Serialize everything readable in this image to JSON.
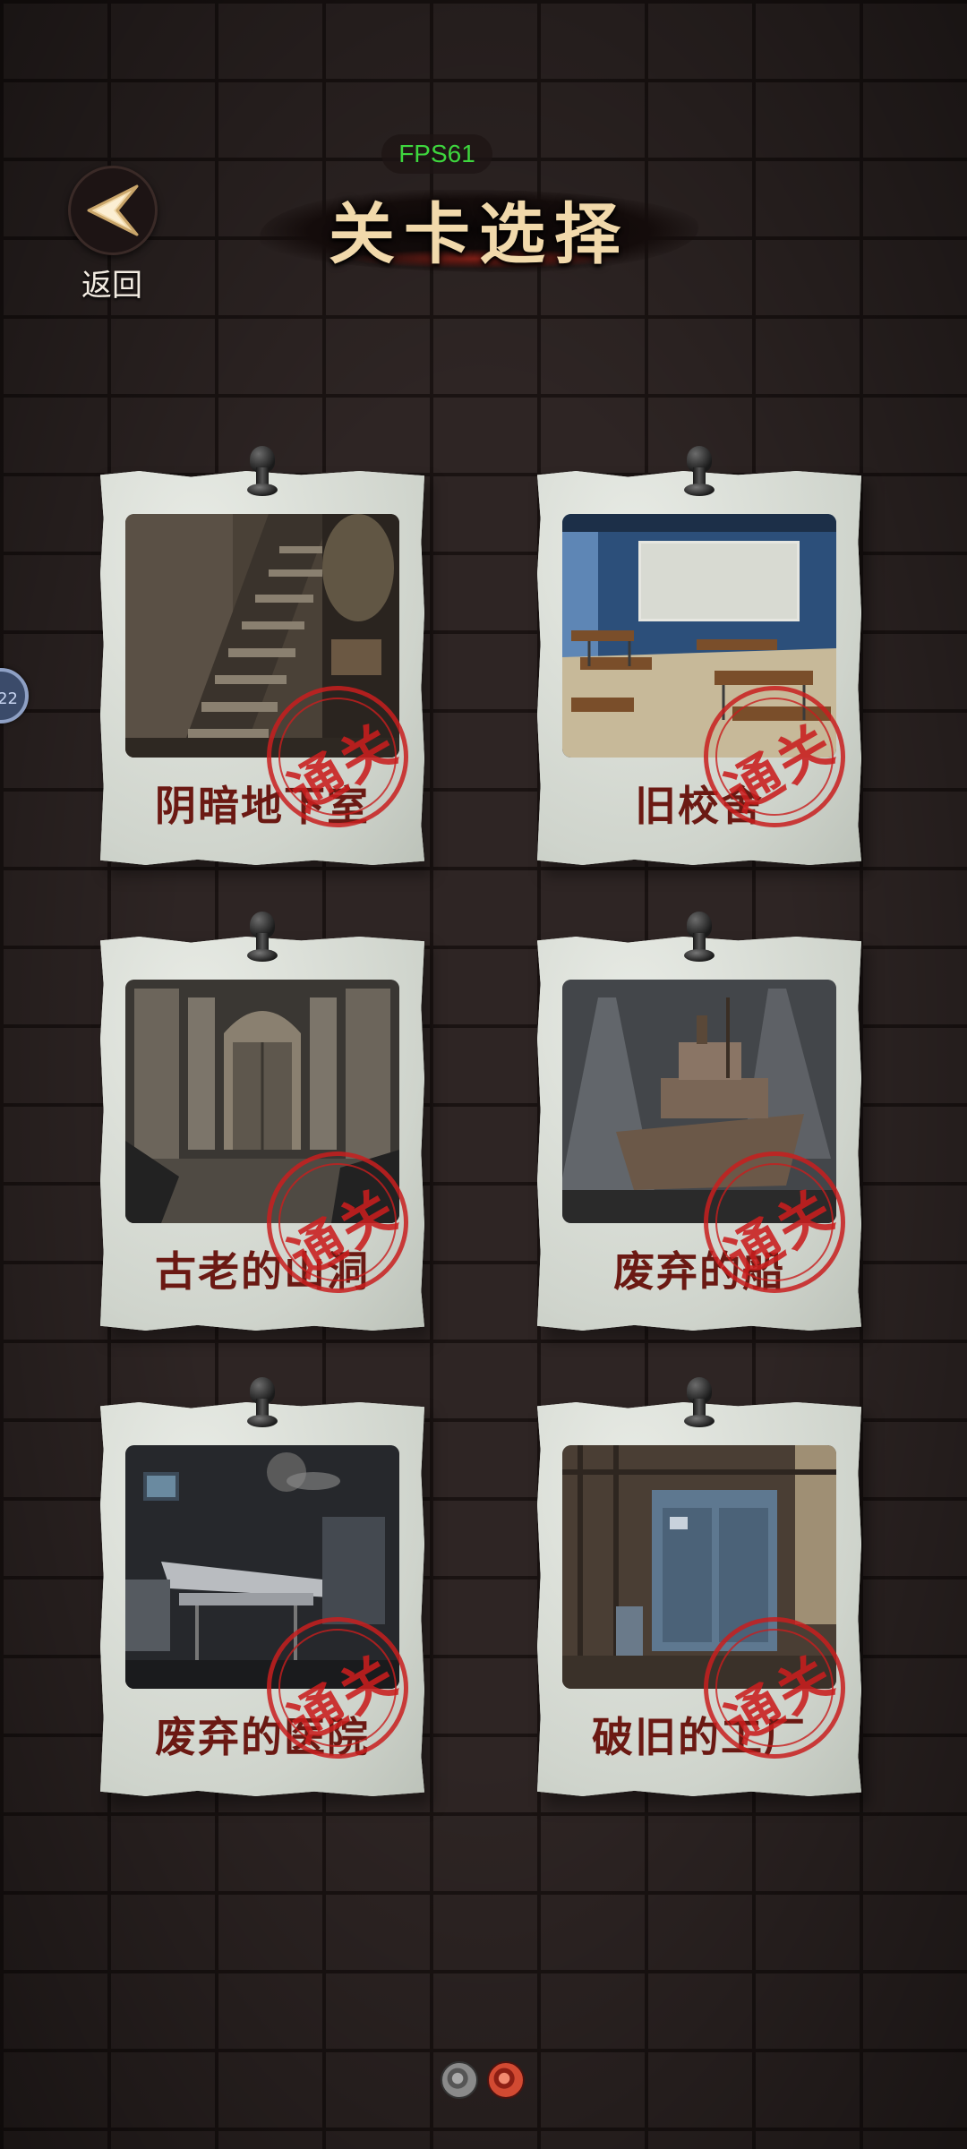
{
  "header": {
    "back_label": "返回",
    "fps": "FPS61",
    "title": "关卡选择"
  },
  "side_tab": {
    "label": "22"
  },
  "levels": [
    {
      "name": "阴暗地下室",
      "stamp": "通关",
      "cleared": true,
      "scene": "basement-stairs"
    },
    {
      "name": "旧校舍",
      "stamp": "通关",
      "cleared": true,
      "scene": "classroom"
    },
    {
      "name": "古老的山洞",
      "stamp": "通关",
      "cleared": true,
      "scene": "cave-gate"
    },
    {
      "name": "废弃的船",
      "stamp": "通关",
      "cleared": true,
      "scene": "ship"
    },
    {
      "name": "废弃的医院",
      "stamp": "通关",
      "cleared": true,
      "scene": "hospital-room"
    },
    {
      "name": "破旧的工厂",
      "stamp": "通关",
      "cleared": true,
      "scene": "factory"
    }
  ],
  "pagination": {
    "pages": 2,
    "current": 2
  },
  "colors": {
    "caption": "#6b1913",
    "stamp": "#c81e1e",
    "title": "#f1d9ab",
    "fps": "#3ed63e",
    "wall": "#2e2524"
  }
}
